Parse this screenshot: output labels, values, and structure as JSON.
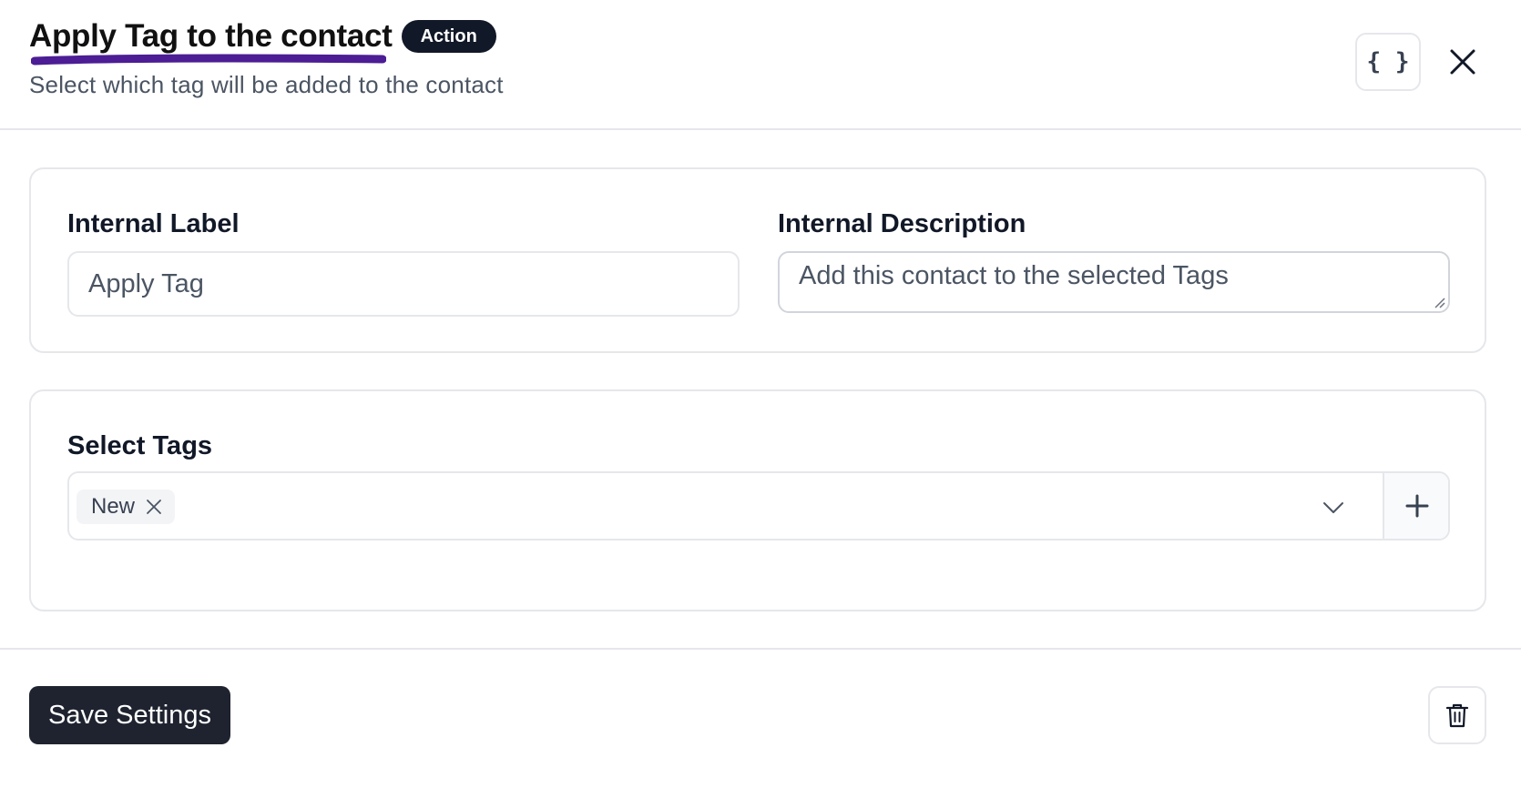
{
  "header": {
    "title": "Apply Tag to the contact",
    "badge": "Action",
    "subtitle": "Select which tag will be added to the contact",
    "code_button_label": "{ }",
    "accent_underline_color": "#4c1d95"
  },
  "general_settings": {
    "internal_label": {
      "label": "Internal Label",
      "value": "Apply Tag"
    },
    "internal_description": {
      "label": "Internal Description",
      "value": "Add this contact to the selected Tags"
    }
  },
  "tags": {
    "label": "Select Tags",
    "selected": [
      "New"
    ],
    "icons": {
      "remove": "x-icon",
      "dropdown": "chevron-down-icon",
      "add": "plus-icon"
    }
  },
  "footer": {
    "save_label": "Save Settings",
    "delete_icon": "trash-icon"
  },
  "colors": {
    "primary_button": "#1f2330",
    "badge_bg": "#111827",
    "border": "#e5e7eb"
  }
}
